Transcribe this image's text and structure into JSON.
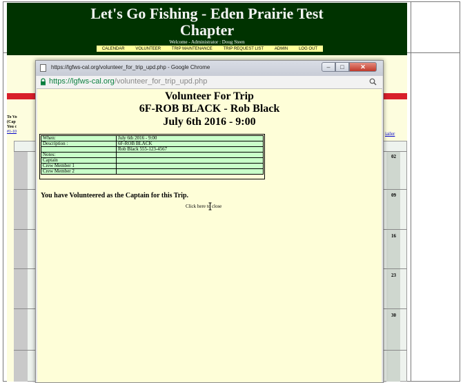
{
  "background_page": {
    "title": "Let's Go Fishing - Eden Prairie Test Chapter",
    "title_line1": "Let's Go Fishing - Eden Prairie Test",
    "title_line2": "Chapter",
    "welcome": "Welcome - Administrator : Doug Steen",
    "nav": [
      "CALENDAR",
      "VOLUNTEER",
      "TRIP MAINTENANCE",
      "TRIP REQUEST LIST",
      "ADMIN",
      "LOG OUT"
    ],
    "left_text_lines": [
      "To Vo",
      "(Cap",
      "You c"
    ],
    "left_link": "#1-10",
    "right_link": "iailer",
    "dates": [
      "02",
      "09",
      "16",
      "23",
      "30"
    ]
  },
  "popup": {
    "window_title": "https://lgfws-cal.org/volunteer_for_trip_upd.php - Google Chrome",
    "url_scheme": "https://",
    "url_host": "lgfws-cal.org",
    "url_path": "/volunteer_for_trip_upd.php",
    "icons": {
      "page": "page-icon",
      "lock": "lock-icon",
      "zoom": "zoom-icon",
      "minimize": "minimize-icon",
      "maximize": "maximize-icon",
      "close": "close-icon"
    },
    "heading1": "Volunteer For Trip",
    "heading2": "6F-ROB BLACK - Rob Black",
    "heading3": "July 6th 2016 - 9:00",
    "table": [
      {
        "label": "When:",
        "value": "July 6th 2016 - 9:00"
      },
      {
        "label": "Description :",
        "value": "6F-ROB BLACK"
      },
      {
        "label": "",
        "value": "Rob Black 555-123-4567"
      },
      {
        "label": "Notes:",
        "value": ""
      },
      {
        "label": "Captain",
        "value": ""
      },
      {
        "label": "Crew Member 1",
        "value": ""
      },
      {
        "label": "Crew Member 2",
        "value": ""
      }
    ],
    "message": "You have Volunteered as the Captain for this Trip.",
    "close_link": "Click here to close"
  },
  "colors": {
    "header_bg": "#003300",
    "nav_bg": "#ffff99",
    "page_bg": "#fdfdde",
    "table_bg": "#c9ffc9",
    "red_bar": "#d81f2a"
  }
}
